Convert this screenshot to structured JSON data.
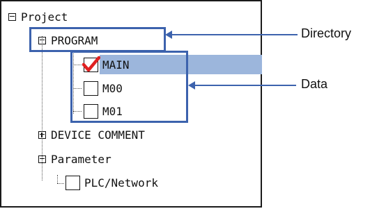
{
  "tree": {
    "root": "Project",
    "program": "PROGRAM",
    "data_items": [
      "MAIN",
      "M00",
      "M01"
    ],
    "device_comment": "DEVICE COMMENT",
    "parameter": "Parameter",
    "plc_network": "PLC/Network"
  },
  "annotations": {
    "directory": "Directory",
    "data": "Data"
  },
  "colors": {
    "callout": "#3c62ad",
    "selection": "#9cb6dc",
    "check": "#e02020"
  }
}
